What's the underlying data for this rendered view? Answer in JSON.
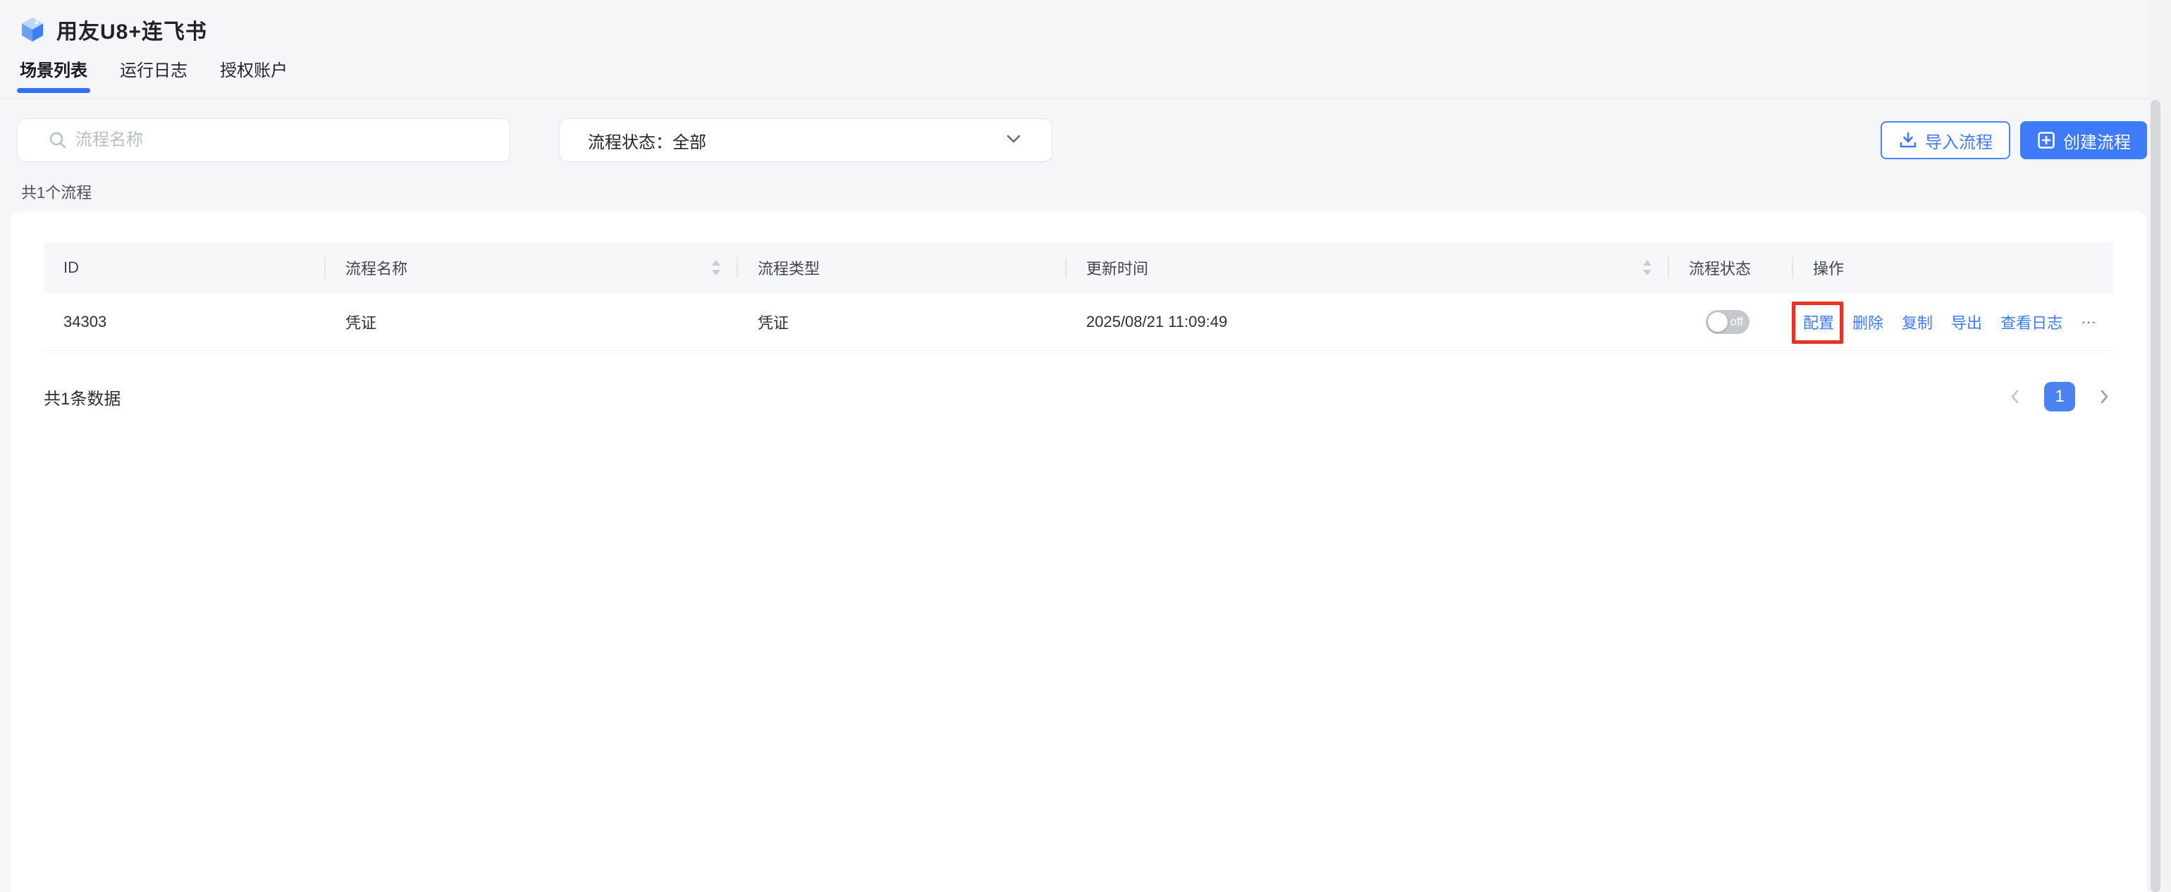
{
  "app": {
    "title": "用友U8+连飞书"
  },
  "tabs": [
    {
      "label": "场景列表",
      "active": true
    },
    {
      "label": "运行日志",
      "active": false
    },
    {
      "label": "授权账户",
      "active": false
    }
  ],
  "filters": {
    "search_placeholder": "流程名称",
    "status_select_value": "流程状态：全部"
  },
  "toolbar": {
    "import_label": "导入流程",
    "create_label": "创建流程"
  },
  "summary": "共1个流程",
  "table": {
    "columns": [
      "ID",
      "流程名称",
      "流程类型",
      "更新时间",
      "流程状态",
      "操作"
    ],
    "rows": [
      {
        "id": "34303",
        "name": "凭证",
        "type": "凭证",
        "updated": "2025/08/21 11:09:49",
        "status_label": "off",
        "status_on": false,
        "actions": [
          "配置",
          "删除",
          "复制",
          "导出",
          "查看日志",
          "···"
        ]
      }
    ]
  },
  "footer": {
    "total": "共1条数据",
    "current_page": "1"
  },
  "icons": {
    "logo": "app-cube-icon",
    "search": "search-icon",
    "select_chevron": "chevron-down-icon",
    "import": "download-tray-icon",
    "create": "plus-square-icon",
    "sort": "sort-carets-icon",
    "prev": "chevron-left-icon",
    "next": "chevron-right-icon"
  },
  "colors": {
    "accent_blue": "#3e7bfa",
    "tab_underline": "#3370ff",
    "annotation_red": "#e83323",
    "toggle_off_gray": "#c5c8cd",
    "page_background": "#f5f6f7"
  }
}
